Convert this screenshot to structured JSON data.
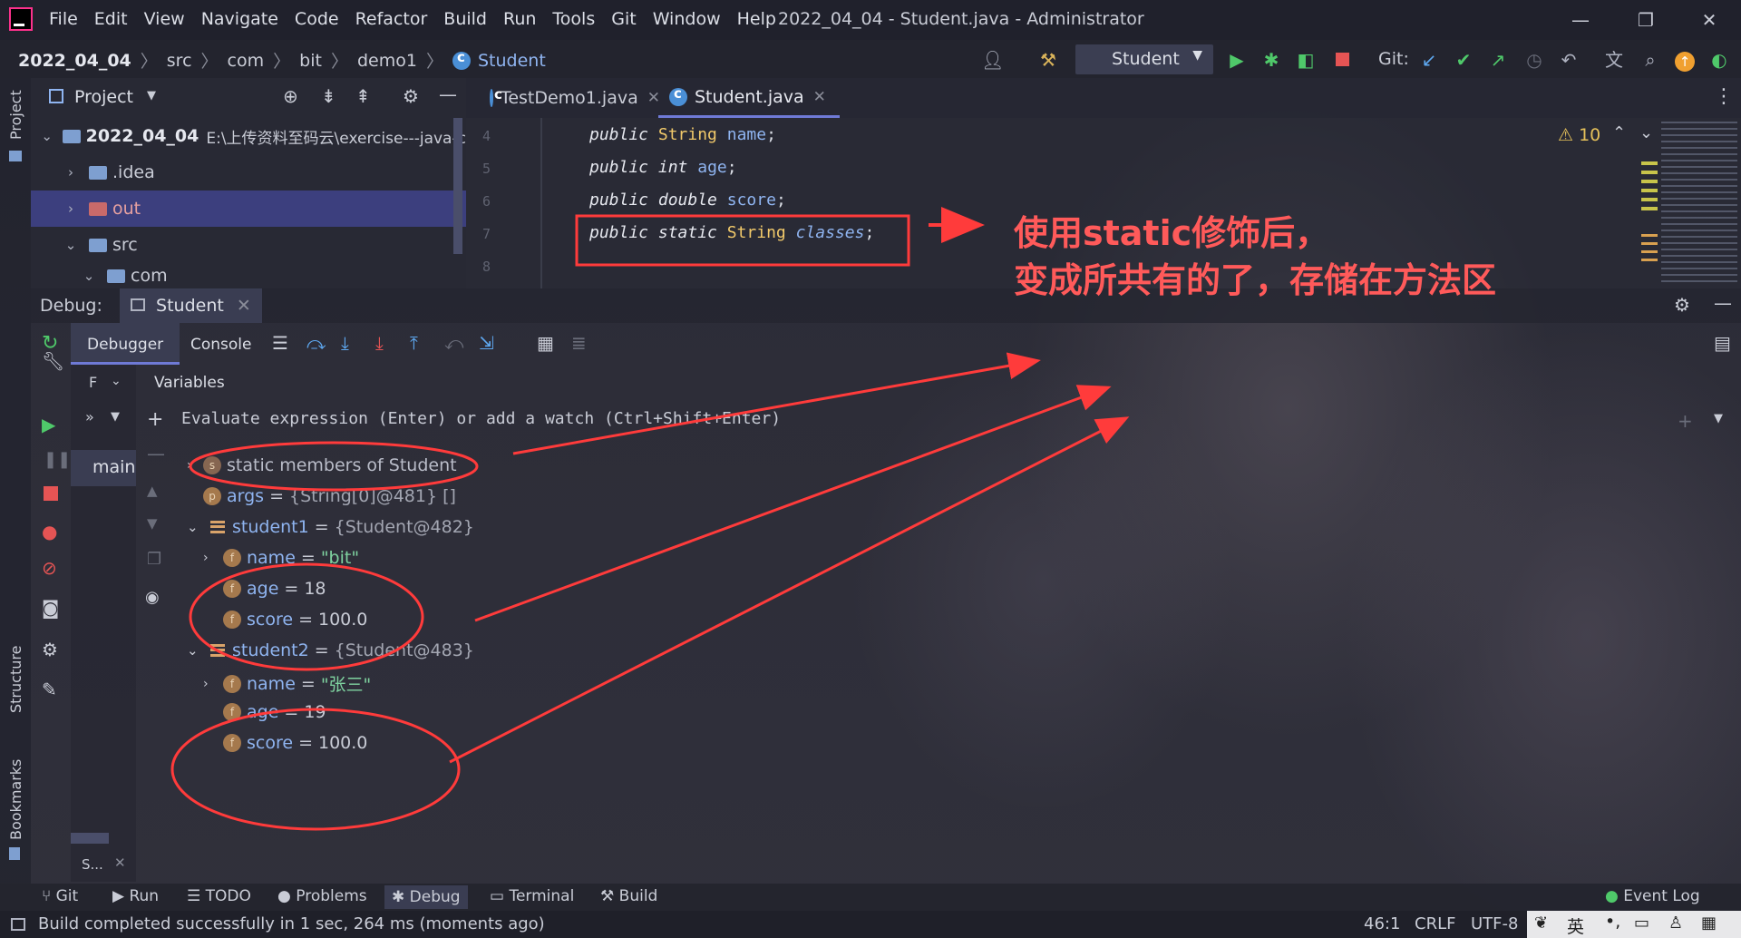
{
  "window": {
    "menu": [
      "File",
      "Edit",
      "View",
      "Navigate",
      "Code",
      "Refactor",
      "Build",
      "Run",
      "Tools",
      "Git",
      "Window",
      "Help"
    ],
    "title": "2022_04_04 - Student.java - Administrator",
    "controls": {
      "minimize": "—",
      "restore": "❐",
      "close": "✕"
    }
  },
  "breadcrumbs": [
    "2022_04_04",
    "src",
    "com",
    "bit",
    "demo1",
    "Student"
  ],
  "toolbar": {
    "run_config": "Student",
    "git_label": "Git:"
  },
  "left_stripe": {
    "project": "Project",
    "structure": "Structure",
    "bookmarks": "Bookmarks"
  },
  "project_panel": {
    "title": "Project",
    "root": {
      "name": "2022_04_04",
      "path": "E:\\上传资料至码云\\exercise---java-co"
    },
    "items": [
      {
        "name": ".idea",
        "expanded": false,
        "selected": false
      },
      {
        "name": "out",
        "expanded": false,
        "selected": true
      },
      {
        "name": "src",
        "expanded": true,
        "selected": false
      },
      {
        "name": "com",
        "expanded": true,
        "selected": false
      }
    ]
  },
  "editor": {
    "tabs": [
      {
        "label": "TestDemo1.java",
        "active": false
      },
      {
        "label": "Student.java",
        "active": true
      }
    ],
    "warnings": "10",
    "lines": [
      {
        "num": "4",
        "kw": "public",
        "type": "String",
        "name": "name",
        "static": ""
      },
      {
        "num": "5",
        "kw": "public",
        "type": "int",
        "name": "age",
        "static": ""
      },
      {
        "num": "6",
        "kw": "public",
        "type": "double",
        "name": "score",
        "static": ""
      },
      {
        "num": "7",
        "kw": "public",
        "type": "String",
        "name": "classes",
        "static": "static"
      },
      {
        "num": "8",
        "kw": "",
        "type": "",
        "name": "",
        "static": ""
      }
    ]
  },
  "annotation": {
    "line1": "使用static修饰后，",
    "line2": "变成所共有的了，存储在方法区"
  },
  "debug": {
    "label": "Debug:",
    "session": "Student",
    "tabs": [
      "Debugger",
      "Console"
    ],
    "frames_label": "F",
    "variables_label": "Variables",
    "thread": "main:",
    "frames_footer": "S...",
    "eval_placeholder": "Evaluate expression (Enter) or add a watch (Ctrl+Shift+Enter)",
    "vars": {
      "static_members": "static members of Student",
      "args": {
        "name": "args",
        "value": "{String[0]@481} []"
      },
      "student1": {
        "name": "student1",
        "value": "{Student@482}",
        "fields": [
          {
            "name": "name",
            "value": "\"bit\""
          },
          {
            "name": "age",
            "value": "18"
          },
          {
            "name": "score",
            "value": "100.0"
          }
        ]
      },
      "student2": {
        "name": "student2",
        "value": "{Student@483}",
        "fields": [
          {
            "name": "name",
            "value": "\"张三\""
          },
          {
            "name": "age",
            "value": "19"
          },
          {
            "name": "score",
            "value": "100.0"
          }
        ]
      }
    }
  },
  "bottom_tabs": [
    "Git",
    "Run",
    "TODO",
    "Problems",
    "Debug",
    "Terminal",
    "Build"
  ],
  "event_log": "Event Log",
  "status": {
    "message": "Build completed successfully in 1 sec, 264 ms (moments ago)",
    "position": "46:1",
    "line_sep": "CRLF",
    "encoding": "UTF-8",
    "ime": "英"
  },
  "colors": {
    "accent": "#6f7ad6",
    "annotation_red": "#ff3b3b",
    "run_green": "#4fc96a",
    "stop_red": "#e55454"
  }
}
